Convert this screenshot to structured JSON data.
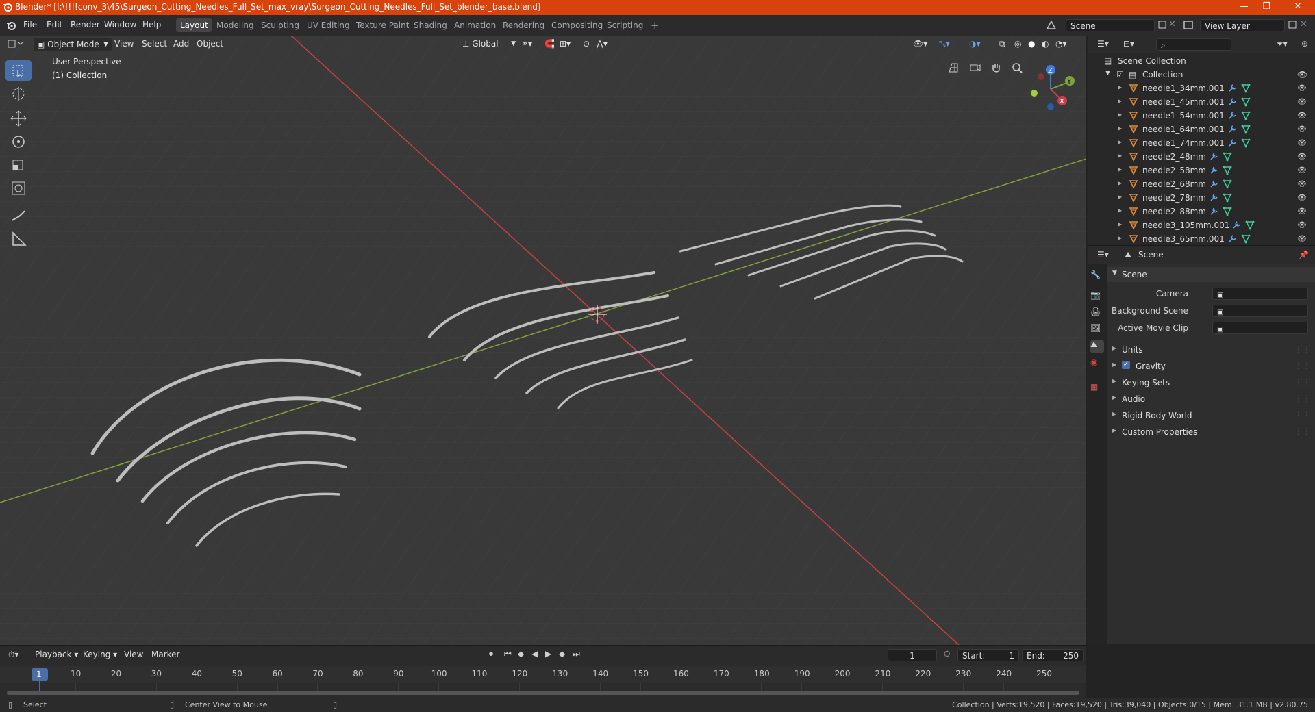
{
  "window": {
    "title": "Blender* [I:\\!!!!conv_3\\45\\Surgeon_Cutting_Needles_Full_Set_max_vray\\Surgeon_Cutting_Needles_Full_Set_blender_base.blend]",
    "controls": [
      "—",
      "❐",
      "✕"
    ]
  },
  "menu": [
    "File",
    "Edit",
    "Render",
    "Window",
    "Help"
  ],
  "workspaces": [
    "Layout",
    "Modeling",
    "Sculpting",
    "UV Editing",
    "Texture Paint",
    "Shading",
    "Animation",
    "Rendering",
    "Compositing",
    "Scripting",
    "+"
  ],
  "active_workspace": "Layout",
  "scene_selector": {
    "value": "Scene"
  },
  "view_layer_selector": {
    "value": "View Layer"
  },
  "viewport": {
    "mode": "Object Mode",
    "menus": [
      "View",
      "Select",
      "Add",
      "Object"
    ],
    "transform_orientation": "Global",
    "overlay_title": "User Perspective",
    "overlay_subtitle": "(1) Collection",
    "gizmo_axes": [
      "Z",
      "Y",
      "X"
    ]
  },
  "outliner": {
    "search_placeholder": "",
    "root": "Scene Collection",
    "collection": "Collection",
    "items": [
      "needle1_34mm.001",
      "needle1_45mm.001",
      "needle1_54mm.001",
      "needle1_64mm.001",
      "needle1_74mm.001",
      "needle2_48mm",
      "needle2_58mm",
      "needle2_68mm",
      "needle2_78mm",
      "needle2_88mm",
      "needle3_105mm.001",
      "needle3_65mm.001"
    ]
  },
  "properties": {
    "context": "Scene",
    "section": "Scene",
    "fields": [
      {
        "label": "Camera",
        "value": ""
      },
      {
        "label": "Background Scene",
        "value": ""
      },
      {
        "label": "Active Movie Clip",
        "value": ""
      }
    ],
    "panels": [
      "Units",
      "Gravity",
      "Keying Sets",
      "Audio",
      "Rigid Body World",
      "Custom Properties"
    ],
    "gravity_checked": true
  },
  "timeline": {
    "menus": [
      "Playback",
      "Keying",
      "View",
      "Marker"
    ],
    "current_frame": "1",
    "start_label": "Start:",
    "start": "1",
    "end_label": "End:",
    "end": "250",
    "ticks": [
      "1",
      "10",
      "20",
      "30",
      "40",
      "50",
      "60",
      "70",
      "80",
      "90",
      "100",
      "110",
      "120",
      "130",
      "140",
      "150",
      "160",
      "170",
      "180",
      "190",
      "200",
      "210",
      "220",
      "230",
      "240",
      "250"
    ]
  },
  "statusbar": {
    "select": "Select",
    "center_view": "Center View to Mouse",
    "stats": "Collection | Verts:19,520 | Faces:19,520 | Tris:39,040 | Objects:0/15 | Mem: 31.1 MB | v2.80.75"
  },
  "colors": {
    "titlebar": "#d8430c",
    "accent": "#4a6ea6",
    "x_axis": "#c84048",
    "y_axis": "#7ea33a",
    "z_axis": "#3f7de0",
    "object_orange": "#e08a3a",
    "mesh_green": "#3fd0a0"
  }
}
